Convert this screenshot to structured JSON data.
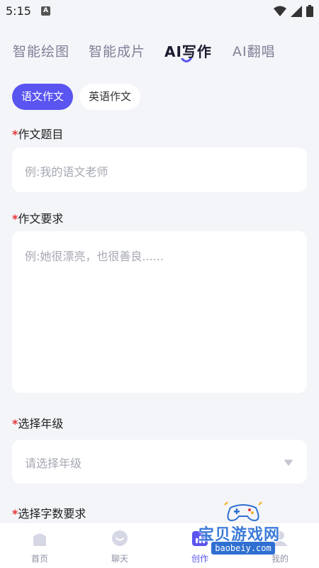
{
  "status_bar": {
    "time": "5:15",
    "indicator": "A"
  },
  "top_tabs": [
    {
      "label": "智能绘图",
      "active": false
    },
    {
      "label": "智能成片",
      "active": false
    },
    {
      "label": "AI写作",
      "active": true
    },
    {
      "label": "AI翻唱",
      "active": false
    }
  ],
  "sub_tabs": [
    {
      "label": "语文作文",
      "active": true
    },
    {
      "label": "英语作文",
      "active": false
    }
  ],
  "form": {
    "required_mark": "*",
    "title": {
      "label": "作文题目",
      "placeholder": "例:我的语文老师"
    },
    "requirement": {
      "label": "作文要求",
      "placeholder": "例:她很漂亮，也很善良......"
    },
    "grade": {
      "label": "选择年级",
      "placeholder": "请选择年级"
    },
    "word_count": {
      "label": "选择字数要求"
    }
  },
  "bottom_nav": [
    {
      "label": "首页",
      "icon": "home-icon"
    },
    {
      "label": "聊天",
      "icon": "chat-icon"
    },
    {
      "label": "创作",
      "icon": "create-icon",
      "active": true
    },
    {
      "label": "我的",
      "icon": "profile-icon"
    }
  ],
  "watermark": {
    "text": "宝贝游戏网",
    "url": "baobeiy.com"
  },
  "colors": {
    "accent": "#5a54f0",
    "required": "#e53535",
    "background": "#f4f5f9"
  }
}
